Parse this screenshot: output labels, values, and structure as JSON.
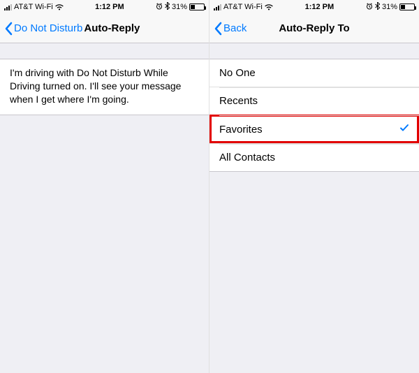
{
  "statusbar": {
    "carrier": "AT&T Wi-Fi",
    "time": "1:12 PM",
    "battery_pct": "31%"
  },
  "left": {
    "back_label": "Do Not Disturb",
    "title": "Auto-Reply",
    "message": "I'm driving with Do Not Disturb While Driving turned on. I'll see your message when I get where I'm going."
  },
  "right": {
    "back_label": "Back",
    "title": "Auto-Reply To",
    "options": {
      "no_one": "No One",
      "recents": "Recents",
      "favorites": "Favorites",
      "all_contacts": "All Contacts"
    },
    "selected": "favorites"
  }
}
